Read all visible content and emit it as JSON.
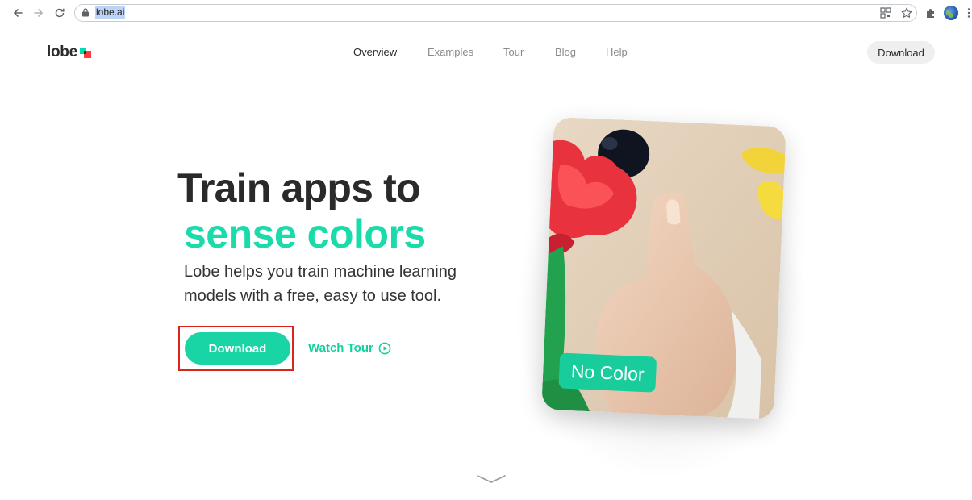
{
  "browser": {
    "url": "lobe.ai",
    "colors": {
      "url_highlight": "#bcd4f6",
      "chrome_icon": "#5f6368"
    }
  },
  "header": {
    "logo_text": "lobe",
    "nav": [
      {
        "label": "Overview",
        "active": true
      },
      {
        "label": "Examples",
        "active": false
      },
      {
        "label": "Tour",
        "active": false
      },
      {
        "label": "Blog",
        "active": false
      },
      {
        "label": "Help",
        "active": false
      }
    ],
    "download_label": "Download"
  },
  "hero": {
    "title_line1": "Train apps to",
    "title_line2": "sense colors",
    "subtitle": "Lobe helps you train machine learning models with a free, easy to use tool.",
    "download_label": "Download",
    "watch_tour_label": "Watch Tour"
  },
  "card": {
    "badge_label": "No Color"
  },
  "colors": {
    "accent": "#19d5a6",
    "heading": "#2a2a2a",
    "highlight_outline": "#d9251c",
    "logo_red": "#ff3b3b",
    "logo_teal": "#00ddb0"
  }
}
